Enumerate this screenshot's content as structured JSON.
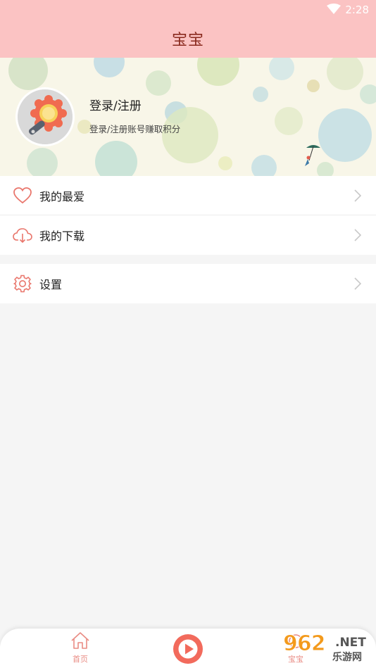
{
  "status_bar": {
    "time": "2:28",
    "wifi_icon": "wifi-icon"
  },
  "header": {
    "title": "宝宝"
  },
  "profile": {
    "login_label": "登录/注册",
    "login_hint": "登录/注册账号赚取积分",
    "avatar_icon": "magnifier-avatar-icon"
  },
  "menu": {
    "group1": [
      {
        "label": "我的最爱",
        "icon": "heart-icon"
      },
      {
        "label": "我的下载",
        "icon": "cloud-download-icon"
      }
    ],
    "group2": [
      {
        "label": "设置",
        "icon": "gear-icon"
      }
    ]
  },
  "bottom_nav": {
    "home_label": "首页",
    "home_icon": "home-icon",
    "play_icon": "play-icon",
    "right_label": "宝宝"
  },
  "watermark": {
    "number": "962",
    "suffix": ".NET",
    "site": "乐游网"
  },
  "colors": {
    "header_bg": "#fbc3c3",
    "title_text": "#8a2a1e",
    "accent": "#e9766c",
    "nav_label": "#e98c84"
  }
}
